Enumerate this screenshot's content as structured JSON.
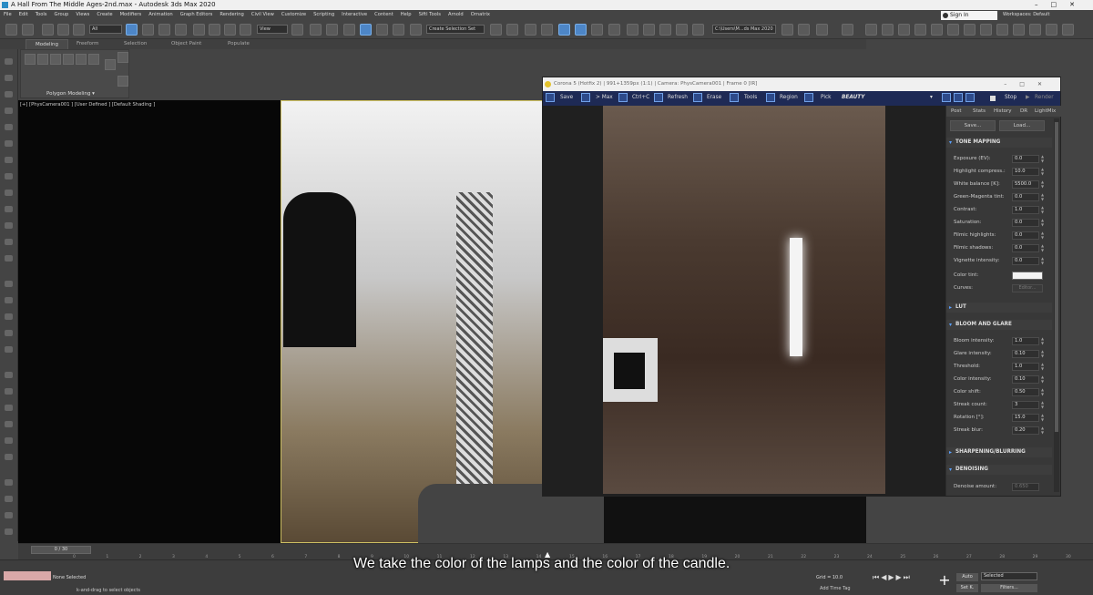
{
  "window_title": "A Hall From The Middle Ages-2nd.max - Autodesk 3ds Max 2020",
  "menu": [
    "File",
    "Edit",
    "Tools",
    "Group",
    "Views",
    "Create",
    "Modifiers",
    "Animation",
    "Graph Editors",
    "Rendering",
    "Civil View",
    "Customize",
    "Scripting",
    "Interactive",
    "Content",
    "Help",
    "Siftl Tools",
    "Arnold",
    "Ornatrix"
  ],
  "sign_in": "Sign In",
  "workspaces_label": "Workspaces: Default",
  "toolbar": {
    "filter_dropdown": "All",
    "view_dropdown": "View",
    "selection_set": "Create Selection Set",
    "path": "C:\\Users\\M...ds Max 2020"
  },
  "ribbon": {
    "tabs": [
      "Modeling",
      "Freeform",
      "Selection",
      "Object Paint",
      "Populate"
    ],
    "active_tab": "Modeling",
    "panel_label": "Polygon Modeling ▾"
  },
  "viewport": {
    "label": "[+] [PhysCamera001 ] [User Defined ] [Default Shading ]"
  },
  "render_window": {
    "title": "Corona 5 (Hotfix 2) | 991+1359px (1:1) | Camera: PhysCamera001 | Frame 0 [IR]",
    "tools": [
      "Save",
      "> Max",
      "Ctrl+C",
      "Refresh",
      "Erase",
      "Tools",
      "Region",
      "Pick",
      "BEAUTY",
      "Stop",
      "Render"
    ],
    "panel_tabs": [
      "Post",
      "Stats",
      "History",
      "DR",
      "LightMix"
    ],
    "save_btn": "Save...",
    "load_btn": "Load...",
    "tone_mapping": {
      "title": "TONE MAPPING",
      "rows": [
        {
          "label": "Exposure (EV):",
          "value": "0.0"
        },
        {
          "label": "Highlight compress.:",
          "value": "10.0"
        },
        {
          "label": "White balance [K]:",
          "value": "5500.0"
        },
        {
          "label": "Green-Magenta tint:",
          "value": "0.0"
        },
        {
          "label": "Contrast:",
          "value": "1.0"
        },
        {
          "label": "Saturation:",
          "value": "0.0"
        },
        {
          "label": "Filmic highlights:",
          "value": "0.0"
        },
        {
          "label": "Filmic shadows:",
          "value": "0.0"
        },
        {
          "label": "Vignette intensity:",
          "value": "0.0"
        }
      ],
      "color_tint_label": "Color tint:",
      "curves_label": "Curves:",
      "editor_btn": "Editor..."
    },
    "lut_title": "LUT",
    "bloom": {
      "title": "BLOOM AND GLARE",
      "rows": [
        {
          "label": "Bloom intensity:",
          "value": "1.0"
        },
        {
          "label": "Glare intensity:",
          "value": "0.10"
        },
        {
          "label": "Threshold:",
          "value": "1.0"
        },
        {
          "label": "Color intensity:",
          "value": "0.10"
        },
        {
          "label": "Color shift:",
          "value": "0.50"
        },
        {
          "label": "Streak count:",
          "value": "3"
        },
        {
          "label": "Rotation [°]:",
          "value": "15.0"
        },
        {
          "label": "Streak blur:",
          "value": "0.20"
        }
      ]
    },
    "sharpening_title": "SHARPENING/BLURRING",
    "denoising": {
      "title": "DENOISING",
      "row": {
        "label": "Denoise amount:",
        "value": "0.650"
      }
    }
  },
  "timeline": {
    "slider": "0 / 30",
    "ticks": [
      "0",
      "1",
      "2",
      "3",
      "4",
      "5",
      "6",
      "7",
      "8",
      "9",
      "10",
      "11",
      "12",
      "13",
      "14",
      "15",
      "16",
      "17",
      "18",
      "19",
      "20",
      "21",
      "22",
      "23",
      "24",
      "25",
      "26",
      "27",
      "28",
      "29",
      "30"
    ]
  },
  "status": {
    "selection": "None Selected",
    "hint": "k-and-drag to select objects",
    "grid": "Grid = 10.0",
    "add_time_tag": "Add Time Tag",
    "auto": "Auto",
    "selected_dropdown": "Selected",
    "set_k": "Set K.",
    "filters": "Filters..."
  },
  "subtitle": "We take the color of the lamps and the color of the candle."
}
